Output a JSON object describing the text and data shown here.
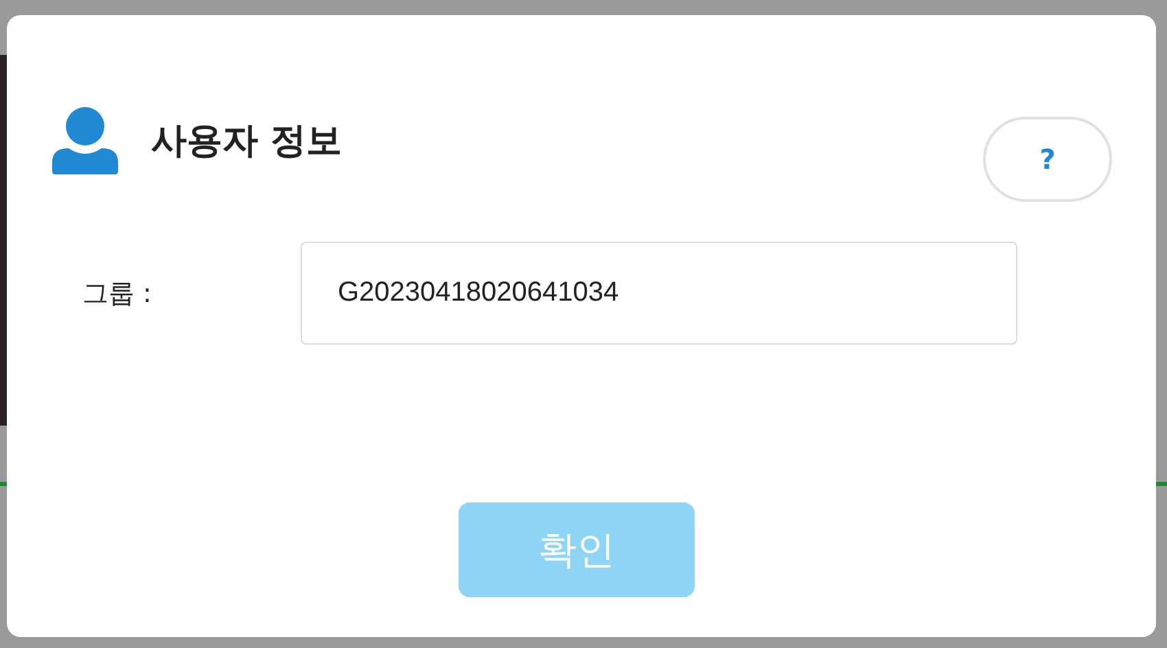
{
  "dialog": {
    "title": "사용자 정보",
    "help_button": "?"
  },
  "fields": [
    {
      "label": "그룹 :",
      "value": "G20230418020641034"
    }
  ],
  "buttons": [
    "확인"
  ]
}
